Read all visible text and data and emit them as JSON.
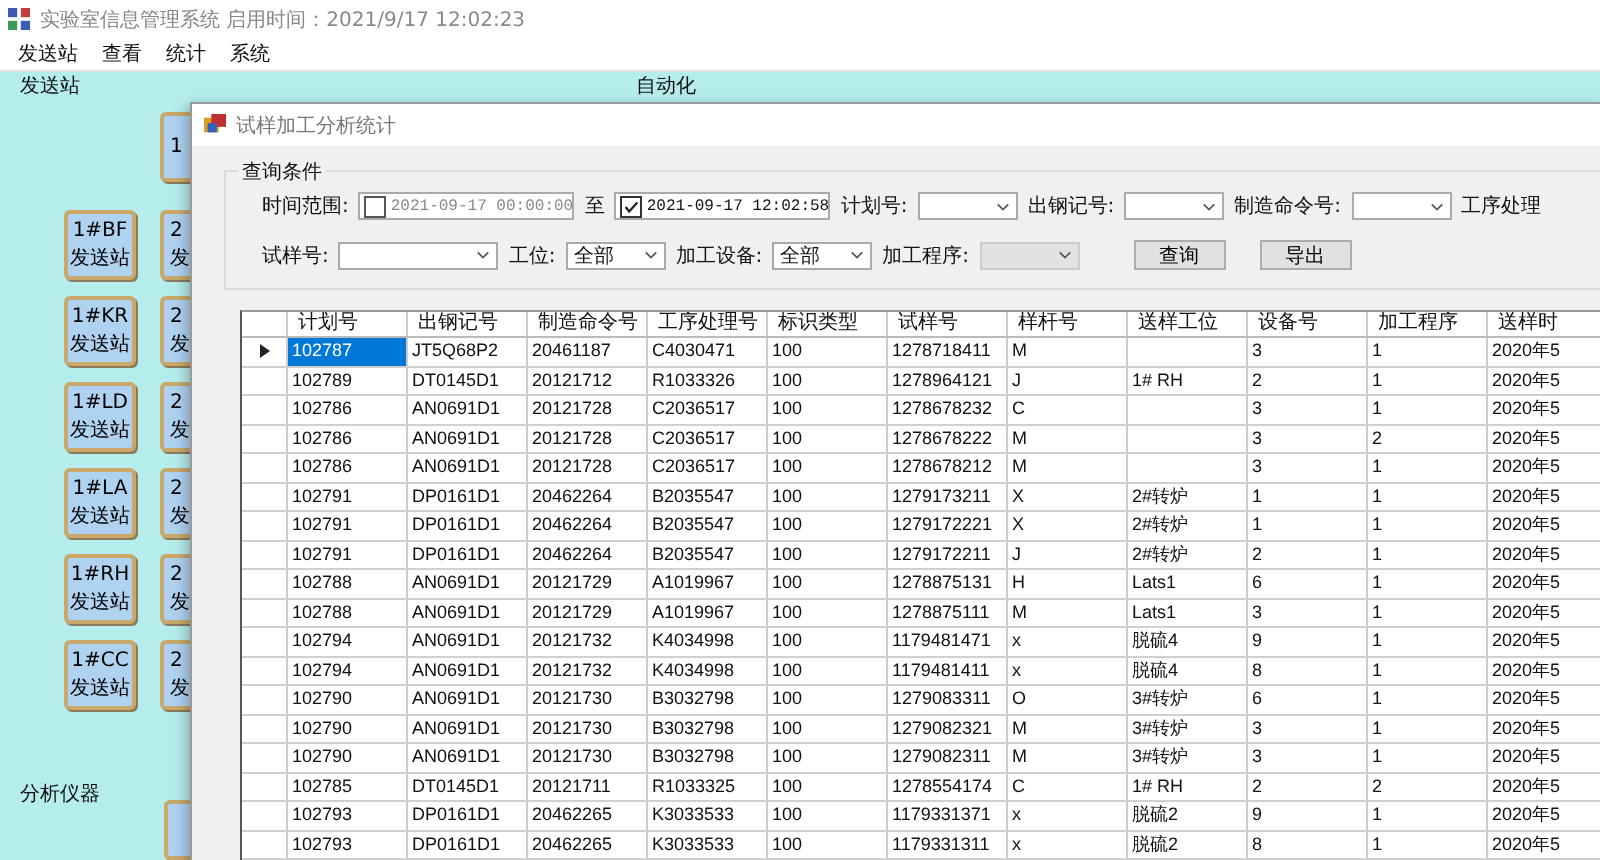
{
  "main_window": {
    "title": "实验室信息管理系统 启用时间：2021/9/17 12:02:23",
    "menu": [
      {
        "label": "发送站"
      },
      {
        "label": "查看"
      },
      {
        "label": "统计"
      },
      {
        "label": "系统"
      }
    ],
    "section_labels": [
      "发送站",
      "自动化",
      "分析仪器"
    ],
    "station_buttons": [
      {
        "lines": [
          "1#BF",
          "发送站"
        ]
      },
      {
        "lines": [
          "1#KR",
          "发送站"
        ]
      },
      {
        "lines": [
          "1#LD",
          "发送站"
        ]
      },
      {
        "lines": [
          "1#LA",
          "发送站"
        ]
      },
      {
        "lines": [
          "1#RH",
          "发送站"
        ]
      },
      {
        "lines": [
          "1#CC",
          "发送站"
        ]
      }
    ],
    "partial_buttons": [
      {
        "lines": [
          "1"
        ]
      },
      {
        "lines": [
          "2",
          "发"
        ]
      },
      {
        "lines": [
          "2",
          "发"
        ]
      },
      {
        "lines": [
          "2",
          "发"
        ]
      },
      {
        "lines": [
          "2",
          "发"
        ]
      },
      {
        "lines": [
          "2",
          "发"
        ]
      },
      {
        "lines": [
          "2",
          "发"
        ]
      }
    ]
  },
  "dialog": {
    "title": "试样加工分析统计",
    "query_group": {
      "title": "查询条件",
      "rows": [
        {
          "fields": [
            {
              "kind": "label",
              "text": "时间范围:"
            },
            {
              "kind": "date",
              "value": "2021-09-17 00:00:00",
              "checked": false
            },
            {
              "kind": "label",
              "text": "至"
            },
            {
              "kind": "date",
              "value": "2021-09-17 12:02:58",
              "checked": true
            },
            {
              "kind": "label",
              "text": "计划号:"
            },
            {
              "kind": "combo",
              "disabled": false
            },
            {
              "kind": "label",
              "text": "出钢记号:"
            },
            {
              "kind": "combo",
              "disabled": false
            },
            {
              "kind": "label",
              "text": "制造命令号:"
            },
            {
              "kind": "combo",
              "disabled": false
            },
            {
              "kind": "label",
              "text": "工序处理"
            }
          ]
        },
        {
          "fields": [
            {
              "kind": "label",
              "text": "试样号:"
            },
            {
              "kind": "combo",
              "disabled": false
            },
            {
              "kind": "label",
              "text": "工位:"
            },
            {
              "kind": "combo",
              "value": "全部",
              "disabled": false
            },
            {
              "kind": "label",
              "text": "加工设备:"
            },
            {
              "kind": "combo",
              "value": "全部",
              "disabled": false
            },
            {
              "kind": "label",
              "text": "加工程序:"
            },
            {
              "kind": "combo",
              "disabled": true
            },
            {
              "kind": "button",
              "text": "查询"
            },
            {
              "kind": "button",
              "text": "导出"
            }
          ]
        }
      ]
    },
    "table": {
      "columns": [
        "计划号",
        "出钢记号",
        "制造命令号",
        "工序处理号",
        "标识类型",
        "试样号",
        "样杆号",
        "送样工位",
        "设备号",
        "加工程序",
        "送样时"
      ],
      "rows": [
        {
          "selected": true,
          "cells": [
            "102787",
            "JT5Q68P2",
            "20461187",
            "C4030471",
            "100",
            "1278718411",
            "M",
            "",
            "3",
            "1",
            "2020年5"
          ]
        },
        {
          "selected": false,
          "cells": [
            "102789",
            "DT0145D1",
            "20121712",
            "R1033326",
            "100",
            "1278964121",
            "J",
            "1# RH",
            "2",
            "1",
            "2020年5"
          ]
        },
        {
          "selected": false,
          "cells": [
            "102786",
            "AN0691D1",
            "20121728",
            "C2036517",
            "100",
            "1278678232",
            "C",
            "",
            "3",
            "1",
            "2020年5"
          ]
        },
        {
          "selected": false,
          "cells": [
            "102786",
            "AN0691D1",
            "20121728",
            "C2036517",
            "100",
            "1278678222",
            "M",
            "",
            "3",
            "2",
            "2020年5"
          ]
        },
        {
          "selected": false,
          "cells": [
            "102786",
            "AN0691D1",
            "20121728",
            "C2036517",
            "100",
            "1278678212",
            "M",
            "",
            "3",
            "1",
            "2020年5"
          ]
        },
        {
          "selected": false,
          "cells": [
            "102791",
            "DP0161D1",
            "20462264",
            "B2035547",
            "100",
            "1279173211",
            "X",
            "2#转炉",
            "1",
            "1",
            "2020年5"
          ]
        },
        {
          "selected": false,
          "cells": [
            "102791",
            "DP0161D1",
            "20462264",
            "B2035547",
            "100",
            "1279172221",
            "X",
            "2#转炉",
            "1",
            "1",
            "2020年5"
          ]
        },
        {
          "selected": false,
          "cells": [
            "102791",
            "DP0161D1",
            "20462264",
            "B2035547",
            "100",
            "1279172211",
            "J",
            "2#转炉",
            "2",
            "1",
            "2020年5"
          ]
        },
        {
          "selected": false,
          "cells": [
            "102788",
            "AN0691D1",
            "20121729",
            "A1019967",
            "100",
            "1278875131",
            "H",
            "Lats1",
            "6",
            "1",
            "2020年5"
          ]
        },
        {
          "selected": false,
          "cells": [
            "102788",
            "AN0691D1",
            "20121729",
            "A1019967",
            "100",
            "1278875111",
            "M",
            "Lats1",
            "3",
            "1",
            "2020年5"
          ]
        },
        {
          "selected": false,
          "cells": [
            "102794",
            "AN0691D1",
            "20121732",
            "K4034998",
            "100",
            "1179481471",
            "x",
            "脱硫4",
            "9",
            "1",
            "2020年5"
          ]
        },
        {
          "selected": false,
          "cells": [
            "102794",
            "AN0691D1",
            "20121732",
            "K4034998",
            "100",
            "1179481411",
            "x",
            "脱硫4",
            "8",
            "1",
            "2020年5"
          ]
        },
        {
          "selected": false,
          "cells": [
            "102790",
            "AN0691D1",
            "20121730",
            "B3032798",
            "100",
            "1279083311",
            "O",
            "3#转炉",
            "6",
            "1",
            "2020年5"
          ]
        },
        {
          "selected": false,
          "cells": [
            "102790",
            "AN0691D1",
            "20121730",
            "B3032798",
            "100",
            "1279082321",
            "M",
            "3#转炉",
            "3",
            "1",
            "2020年5"
          ]
        },
        {
          "selected": false,
          "cells": [
            "102790",
            "AN0691D1",
            "20121730",
            "B3032798",
            "100",
            "1279082311",
            "M",
            "3#转炉",
            "3",
            "1",
            "2020年5"
          ]
        },
        {
          "selected": false,
          "cells": [
            "102785",
            "DT0145D1",
            "20121711",
            "R1033325",
            "100",
            "1278554174",
            "C",
            "1# RH",
            "2",
            "2",
            "2020年5"
          ]
        },
        {
          "selected": false,
          "cells": [
            "102793",
            "DP0161D1",
            "20462265",
            "K3033533",
            "100",
            "1179331371",
            "x",
            "脱硫2",
            "9",
            "1",
            "2020年5"
          ]
        },
        {
          "selected": false,
          "cells": [
            "102793",
            "DP0161D1",
            "20462265",
            "K3033533",
            "100",
            "1179331311",
            "x",
            "脱硫2",
            "8",
            "1",
            "2020年5"
          ]
        }
      ]
    }
  }
}
